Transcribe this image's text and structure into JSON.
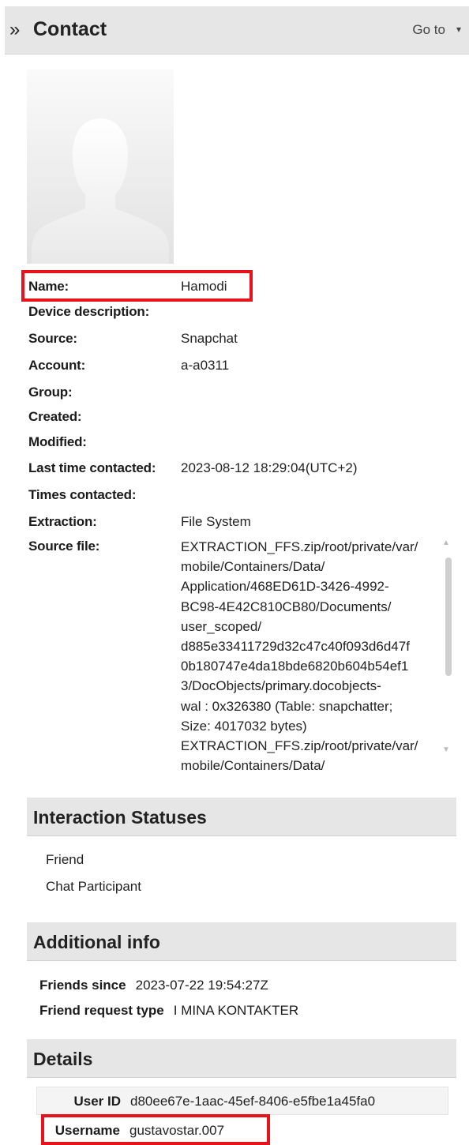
{
  "header": {
    "chevron": "»",
    "title": "Contact",
    "goto_label": "Go to",
    "goto_caret": "▾"
  },
  "avatar_icon": "person-silhouette-icon",
  "fields": [
    {
      "label": "Name:",
      "value": "Hamodi"
    },
    {
      "label": "Device description:",
      "value": ""
    },
    {
      "label": "Source:",
      "value": "Snapchat"
    },
    {
      "label": "Account:",
      "value": "a-a0311"
    },
    {
      "label": "Group:",
      "value": ""
    },
    {
      "label": "Created:",
      "value": ""
    },
    {
      "label": "Modified:",
      "value": ""
    },
    {
      "label": "Last time contacted:",
      "value": "2023-08-12 18:29:04(UTC+2)"
    },
    {
      "label": "Times contacted:",
      "value": ""
    },
    {
      "label": "Extraction:",
      "value": "File System"
    }
  ],
  "source_file": {
    "label": "Source file:",
    "lines": [
      "EXTRACTION_FFS.zip/root/private/var/",
      "mobile/Containers/Data/",
      "Application/468ED61D-3426-4992-",
      "BC98-4E42C810CB80/Documents/",
      "user_scoped/",
      "d885e33411729d32c47c40f093d6d47f",
      "0b180747e4da18bde6820b604b54ef1",
      "3/DocObjects/primary.docobjects-",
      "wal : 0x326380 (Table: snapchatter;",
      "Size: 4017032 bytes)",
      "EXTRACTION_FFS.zip/root/private/var/",
      "mobile/Containers/Data/"
    ]
  },
  "interaction_statuses": {
    "title": "Interaction Statuses",
    "items": [
      "Friend",
      "Chat Participant"
    ]
  },
  "additional_info": {
    "title": "Additional info",
    "rows": [
      {
        "key": "Friends since",
        "value": "2023-07-22 19:54:27Z"
      },
      {
        "key": "Friend request type",
        "value": "I MINA KONTAKTER"
      }
    ]
  },
  "details": {
    "title": "Details",
    "rows": [
      {
        "key": "User ID",
        "value": "d80ee67e-1aac-45ef-8406-e5fbe1a45fa0"
      },
      {
        "key": "Username",
        "value": "gustavostar.007"
      }
    ]
  },
  "highlight_color": "#e8121a"
}
